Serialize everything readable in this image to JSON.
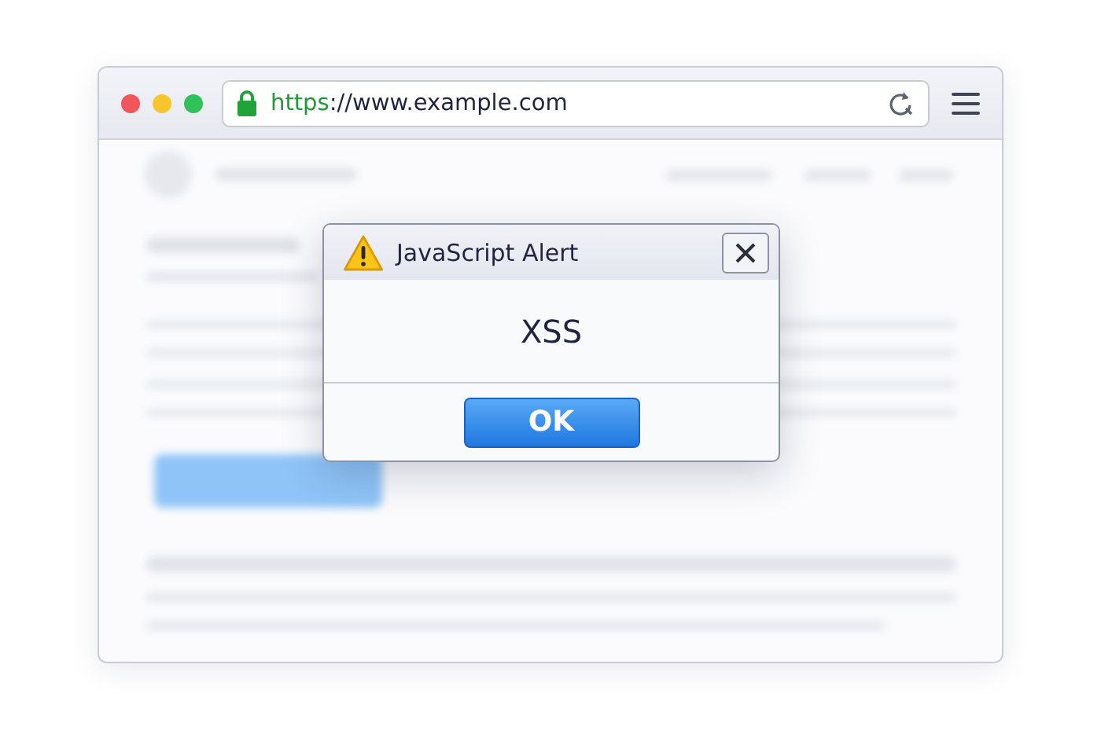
{
  "browser": {
    "url": {
      "scheme": "https",
      "rest": "://www.example.com"
    },
    "secure": true
  },
  "dialog": {
    "title": "JavaScript Alert",
    "message": "XSS",
    "buttons": [
      "OK"
    ]
  }
}
